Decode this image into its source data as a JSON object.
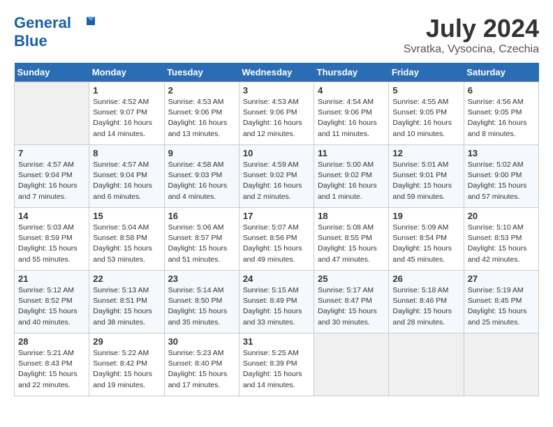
{
  "header": {
    "logo_line1": "General",
    "logo_line2": "Blue",
    "month": "July 2024",
    "location": "Svratka, Vysocina, Czechia"
  },
  "weekdays": [
    "Sunday",
    "Monday",
    "Tuesday",
    "Wednesday",
    "Thursday",
    "Friday",
    "Saturday"
  ],
  "weeks": [
    [
      {
        "day": "",
        "sunrise": "",
        "sunset": "",
        "daylight": ""
      },
      {
        "day": "1",
        "sunrise": "Sunrise: 4:52 AM",
        "sunset": "Sunset: 9:07 PM",
        "daylight": "Daylight: 16 hours and 14 minutes."
      },
      {
        "day": "2",
        "sunrise": "Sunrise: 4:53 AM",
        "sunset": "Sunset: 9:06 PM",
        "daylight": "Daylight: 16 hours and 13 minutes."
      },
      {
        "day": "3",
        "sunrise": "Sunrise: 4:53 AM",
        "sunset": "Sunset: 9:06 PM",
        "daylight": "Daylight: 16 hours and 12 minutes."
      },
      {
        "day": "4",
        "sunrise": "Sunrise: 4:54 AM",
        "sunset": "Sunset: 9:06 PM",
        "daylight": "Daylight: 16 hours and 11 minutes."
      },
      {
        "day": "5",
        "sunrise": "Sunrise: 4:55 AM",
        "sunset": "Sunset: 9:05 PM",
        "daylight": "Daylight: 16 hours and 10 minutes."
      },
      {
        "day": "6",
        "sunrise": "Sunrise: 4:56 AM",
        "sunset": "Sunset: 9:05 PM",
        "daylight": "Daylight: 16 hours and 8 minutes."
      }
    ],
    [
      {
        "day": "7",
        "sunrise": "Sunrise: 4:57 AM",
        "sunset": "Sunset: 9:04 PM",
        "daylight": "Daylight: 16 hours and 7 minutes."
      },
      {
        "day": "8",
        "sunrise": "Sunrise: 4:57 AM",
        "sunset": "Sunset: 9:04 PM",
        "daylight": "Daylight: 16 hours and 6 minutes."
      },
      {
        "day": "9",
        "sunrise": "Sunrise: 4:58 AM",
        "sunset": "Sunset: 9:03 PM",
        "daylight": "Daylight: 16 hours and 4 minutes."
      },
      {
        "day": "10",
        "sunrise": "Sunrise: 4:59 AM",
        "sunset": "Sunset: 9:02 PM",
        "daylight": "Daylight: 16 hours and 2 minutes."
      },
      {
        "day": "11",
        "sunrise": "Sunrise: 5:00 AM",
        "sunset": "Sunset: 9:02 PM",
        "daylight": "Daylight: 16 hours and 1 minute."
      },
      {
        "day": "12",
        "sunrise": "Sunrise: 5:01 AM",
        "sunset": "Sunset: 9:01 PM",
        "daylight": "Daylight: 15 hours and 59 minutes."
      },
      {
        "day": "13",
        "sunrise": "Sunrise: 5:02 AM",
        "sunset": "Sunset: 9:00 PM",
        "daylight": "Daylight: 15 hours and 57 minutes."
      }
    ],
    [
      {
        "day": "14",
        "sunrise": "Sunrise: 5:03 AM",
        "sunset": "Sunset: 8:59 PM",
        "daylight": "Daylight: 15 hours and 55 minutes."
      },
      {
        "day": "15",
        "sunrise": "Sunrise: 5:04 AM",
        "sunset": "Sunset: 8:58 PM",
        "daylight": "Daylight: 15 hours and 53 minutes."
      },
      {
        "day": "16",
        "sunrise": "Sunrise: 5:06 AM",
        "sunset": "Sunset: 8:57 PM",
        "daylight": "Daylight: 15 hours and 51 minutes."
      },
      {
        "day": "17",
        "sunrise": "Sunrise: 5:07 AM",
        "sunset": "Sunset: 8:56 PM",
        "daylight": "Daylight: 15 hours and 49 minutes."
      },
      {
        "day": "18",
        "sunrise": "Sunrise: 5:08 AM",
        "sunset": "Sunset: 8:55 PM",
        "daylight": "Daylight: 15 hours and 47 minutes."
      },
      {
        "day": "19",
        "sunrise": "Sunrise: 5:09 AM",
        "sunset": "Sunset: 8:54 PM",
        "daylight": "Daylight: 15 hours and 45 minutes."
      },
      {
        "day": "20",
        "sunrise": "Sunrise: 5:10 AM",
        "sunset": "Sunset: 8:53 PM",
        "daylight": "Daylight: 15 hours and 42 minutes."
      }
    ],
    [
      {
        "day": "21",
        "sunrise": "Sunrise: 5:12 AM",
        "sunset": "Sunset: 8:52 PM",
        "daylight": "Daylight: 15 hours and 40 minutes."
      },
      {
        "day": "22",
        "sunrise": "Sunrise: 5:13 AM",
        "sunset": "Sunset: 8:51 PM",
        "daylight": "Daylight: 15 hours and 38 minutes."
      },
      {
        "day": "23",
        "sunrise": "Sunrise: 5:14 AM",
        "sunset": "Sunset: 8:50 PM",
        "daylight": "Daylight: 15 hours and 35 minutes."
      },
      {
        "day": "24",
        "sunrise": "Sunrise: 5:15 AM",
        "sunset": "Sunset: 8:49 PM",
        "daylight": "Daylight: 15 hours and 33 minutes."
      },
      {
        "day": "25",
        "sunrise": "Sunrise: 5:17 AM",
        "sunset": "Sunset: 8:47 PM",
        "daylight": "Daylight: 15 hours and 30 minutes."
      },
      {
        "day": "26",
        "sunrise": "Sunrise: 5:18 AM",
        "sunset": "Sunset: 8:46 PM",
        "daylight": "Daylight: 15 hours and 28 minutes."
      },
      {
        "day": "27",
        "sunrise": "Sunrise: 5:19 AM",
        "sunset": "Sunset: 8:45 PM",
        "daylight": "Daylight: 15 hours and 25 minutes."
      }
    ],
    [
      {
        "day": "28",
        "sunrise": "Sunrise: 5:21 AM",
        "sunset": "Sunset: 8:43 PM",
        "daylight": "Daylight: 15 hours and 22 minutes."
      },
      {
        "day": "29",
        "sunrise": "Sunrise: 5:22 AM",
        "sunset": "Sunset: 8:42 PM",
        "daylight": "Daylight: 15 hours and 19 minutes."
      },
      {
        "day": "30",
        "sunrise": "Sunrise: 5:23 AM",
        "sunset": "Sunset: 8:40 PM",
        "daylight": "Daylight: 15 hours and 17 minutes."
      },
      {
        "day": "31",
        "sunrise": "Sunrise: 5:25 AM",
        "sunset": "Sunset: 8:39 PM",
        "daylight": "Daylight: 15 hours and 14 minutes."
      },
      {
        "day": "",
        "sunrise": "",
        "sunset": "",
        "daylight": ""
      },
      {
        "day": "",
        "sunrise": "",
        "sunset": "",
        "daylight": ""
      },
      {
        "day": "",
        "sunrise": "",
        "sunset": "",
        "daylight": ""
      }
    ]
  ]
}
